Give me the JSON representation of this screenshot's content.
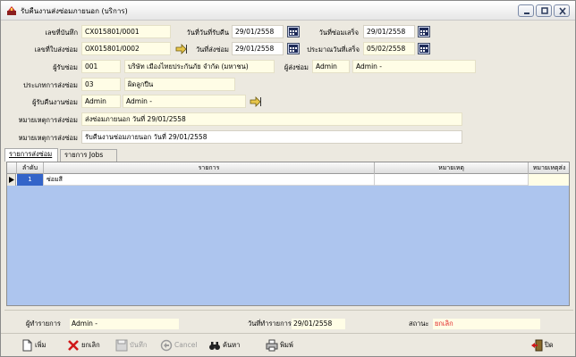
{
  "window": {
    "title": "รับคืนงานส่งซ่อมภายนอก (บริการ)"
  },
  "form": {
    "receive_no_label": "เลขที่บันทึก",
    "receive_no": "CX015801/0001",
    "receive_date_label": "วันที่วันที่รับคืน",
    "receive_date": "29/01/2558",
    "repair_done_label": "วันที่ซ่อมเสร็จ",
    "repair_done_date": "29/01/2558",
    "send_no_label": "เลขที่ใบส่งซ่อม",
    "send_no": "OX015801/0002",
    "send_date_label": "วันที่ส่งซ่อม",
    "send_date": "29/01/2558",
    "est_done_label": "ประมาณวันที่เสร็จ",
    "est_done_date": "05/02/2558",
    "repairer_label": "ผู้รับซ่อม",
    "repairer_code": "001",
    "repairer_name": "บริษัท เมืองไทยประกันภัย จำกัด (มหาชน)",
    "sender_label": "ผู้ส่งซ่อม",
    "sender_code": "Admin",
    "sender_name": "Admin -",
    "repair_type_label": "ประเภทการส่งซ่อม",
    "repair_type_code": "03",
    "repair_type_name": "ผิดลูกปืน",
    "receiver_label": "ผู้รับคืนงานซ่อม",
    "receiver_code": "Admin",
    "receiver_name": "Admin -",
    "send_note_label": "หมายเหตุการส่งซ่อม",
    "send_note": "ส่งซ่อมภายนอก วันที่ 29/01/2558",
    "receive_note_label": "หมายเหตุการส่งซ่อม",
    "receive_note": "รับคืนงานซ่อมภายนอก วันที่ 29/01/2558"
  },
  "tabs": [
    {
      "label": "รายการส่งซ่อม"
    },
    {
      "label": "รายการ Jobs"
    }
  ],
  "grid": {
    "headers": [
      "ลำดับ",
      "รายการ",
      "หมายเหตุ",
      "หมายเหตุส่ง"
    ],
    "rows": [
      {
        "no": "1",
        "item": "ซ่อมสี",
        "note": "",
        "send_note": ""
      }
    ]
  },
  "footer": {
    "creator_label": "ผู้ทำรายการ",
    "creator": "Admin -",
    "created_date_label": "วันที่ทำรายการ",
    "created_date": "29/01/2558",
    "status_label": "สถานะ",
    "status": "ยกเลิก",
    "status_color": "#e01b1b"
  },
  "toolbar": {
    "new": "เพิ่ม",
    "cancel_doc": "ยกเลิก",
    "save": "บันทึก",
    "cancel": "Cancel",
    "search": "ค้นหา",
    "print": "พิมพ์",
    "close": "ปิด"
  }
}
